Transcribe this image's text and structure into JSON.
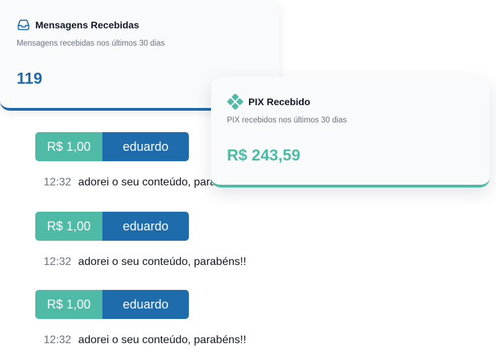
{
  "messages_card": {
    "icon": "inbox-icon",
    "title": "Mensagens Recebidas",
    "subtitle": "Mensagens recebidas nos últimos 30 dias",
    "value": "119",
    "accent": "#1f6cad"
  },
  "pix_card": {
    "icon": "pix-icon",
    "title": "PIX Recebido",
    "subtitle": "PIX recebidos nos últimos 30 dias",
    "value": "R$ 243,59",
    "accent": "#4fbaa6"
  },
  "messages": [
    {
      "amount": "R$ 1,00",
      "name": "eduardo",
      "time": "12:32",
      "text": "adorei o seu conteúdo, parabéns!!"
    },
    {
      "amount": "R$ 1,00",
      "name": "eduardo",
      "time": "12:32",
      "text": "adorei o seu conteúdo, parabéns!!"
    },
    {
      "amount": "R$ 1,00",
      "name": "eduardo",
      "time": "12:32",
      "text": "adorei o seu conteúdo, parabéns!!"
    }
  ]
}
